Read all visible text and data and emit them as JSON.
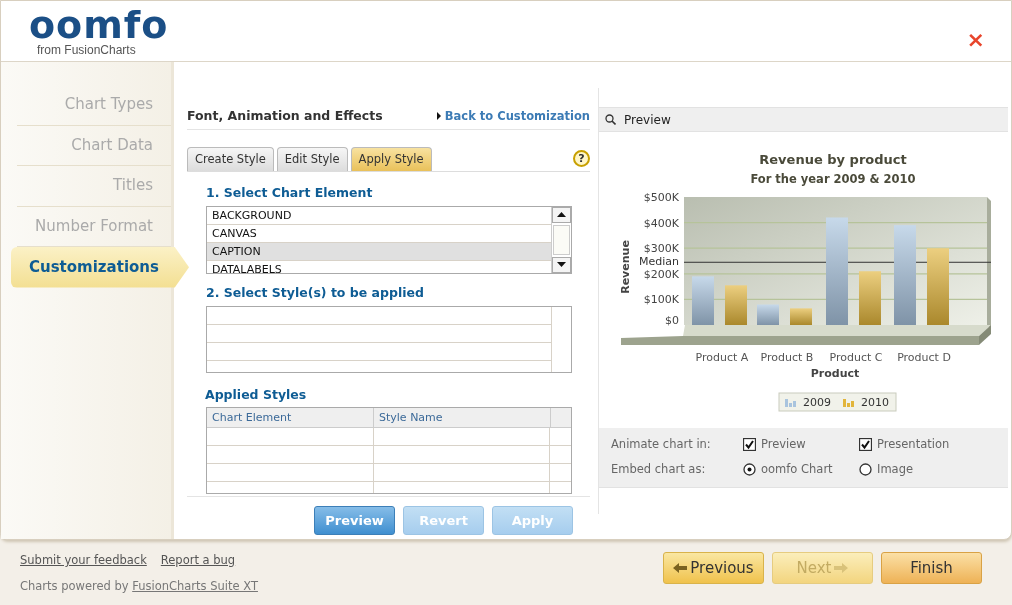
{
  "header": {
    "logo": "oomfo",
    "logo_sub": "from FusionCharts",
    "close": "×"
  },
  "sidebar": {
    "items": [
      {
        "label": "Chart Types",
        "selected": false
      },
      {
        "label": "Chart Data",
        "selected": false
      },
      {
        "label": "Titles",
        "selected": false
      },
      {
        "label": "Number Format",
        "selected": false
      },
      {
        "label": "Customizations",
        "selected": true
      }
    ]
  },
  "editor": {
    "title": "Font, Animation and Effects",
    "back_link": "Back to Customization",
    "tabs": [
      {
        "label": "Create Style",
        "selected": false
      },
      {
        "label": "Edit Style",
        "selected": false
      },
      {
        "label": "Apply Style",
        "selected": true
      }
    ],
    "help": "?",
    "section_1": "1. Select Chart Element",
    "elements": [
      {
        "label": "BACKGROUND",
        "selected": false
      },
      {
        "label": "CANVAS",
        "selected": false
      },
      {
        "label": "CAPTION",
        "selected": true
      },
      {
        "label": "DATALABELS",
        "selected": false
      }
    ],
    "section_2": "2. Select Style(s) to be applied",
    "applied_title": "Applied Styles",
    "applied_columns": [
      "Chart Element",
      "Style Name"
    ],
    "buttons": [
      {
        "label": "Preview",
        "disabled": false
      },
      {
        "label": "Revert",
        "disabled": true
      },
      {
        "label": "Apply",
        "disabled": true
      }
    ]
  },
  "preview": {
    "title": "Preview",
    "subtitle": "For the year 2009 & 2010",
    "chart_data": {
      "type": "bar",
      "title": "Revenue by product",
      "xlabel": "Product",
      "ylabel": "Revenue",
      "categories": [
        "Product A",
        "Product B",
        "Product C",
        "Product D"
      ],
      "series": [
        {
          "name": "2009",
          "color": "#a9c4de",
          "values": [
            190000,
            80000,
            420000,
            390000
          ]
        },
        {
          "name": "2010",
          "color": "#e2b53b",
          "values": [
            155000,
            65000,
            210000,
            300000
          ]
        }
      ],
      "ylim": [
        0,
        500000
      ],
      "yticks": [
        {
          "value": 0,
          "label": "$0"
        },
        {
          "value": 100000,
          "label": "$100K"
        },
        {
          "value": 200000,
          "label": "$200K"
        },
        {
          "value": 300000,
          "label": "$300K"
        },
        {
          "value": 400000,
          "label": "$400K"
        },
        {
          "value": 500000,
          "label": "$500K"
        }
      ],
      "grid": true,
      "legend": "bottom",
      "ref_lines": [
        {
          "axis": "y",
          "value": 245000,
          "label": "Median"
        }
      ]
    },
    "animate_label": "Animate chart in:",
    "animate_options": [
      {
        "label": "Preview",
        "checked": true
      },
      {
        "label": "Presentation",
        "checked": true
      }
    ],
    "embed_label": "Embed chart as:",
    "embed_options": [
      {
        "label": "oomfo Chart",
        "selected": true
      },
      {
        "label": "Image",
        "selected": false
      }
    ]
  },
  "footer": {
    "links": [
      "Submit your feedback",
      "Report a bug"
    ],
    "powered_text": "Charts powered by",
    "powered_link": "FusionCharts Suite XT",
    "buttons": [
      {
        "label": "Previous",
        "kind": "back",
        "disabled": false
      },
      {
        "label": "Next",
        "kind": "forward",
        "disabled": true
      },
      {
        "label": "Finish",
        "kind": "finish",
        "disabled": false
      }
    ]
  }
}
